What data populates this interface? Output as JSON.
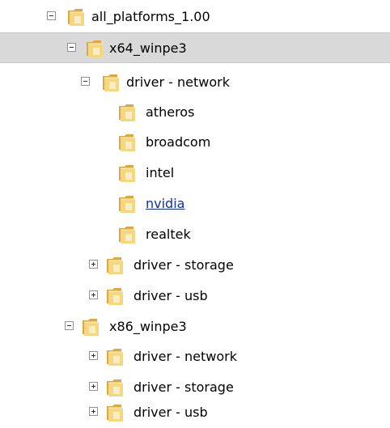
{
  "tree": {
    "items": [
      {
        "label": "all_platforms_1.00",
        "expander": "minus",
        "selected": false,
        "link": false
      },
      {
        "label": "x64_winpe3",
        "expander": "minus",
        "selected": true,
        "link": false
      },
      {
        "label": "driver - network",
        "expander": "minus",
        "selected": false,
        "link": false
      },
      {
        "label": "atheros",
        "expander": "none",
        "selected": false,
        "link": false
      },
      {
        "label": "broadcom",
        "expander": "none",
        "selected": false,
        "link": false
      },
      {
        "label": "intel",
        "expander": "none",
        "selected": false,
        "link": false
      },
      {
        "label": "nvidia",
        "expander": "none",
        "selected": false,
        "link": true
      },
      {
        "label": "realtek",
        "expander": "none",
        "selected": false,
        "link": false
      },
      {
        "label": "driver - storage",
        "expander": "plus",
        "selected": false,
        "link": false
      },
      {
        "label": "driver - usb",
        "expander": "plus",
        "selected": false,
        "link": false
      },
      {
        "label": "x86_winpe3",
        "expander": "minus",
        "selected": false,
        "link": false
      },
      {
        "label": "driver - network",
        "expander": "plus",
        "selected": false,
        "link": false
      },
      {
        "label": "driver - storage",
        "expander": "plus",
        "selected": false,
        "link": false
      },
      {
        "label": "driver - usb",
        "expander": "plus",
        "selected": false,
        "link": false
      }
    ]
  },
  "colors": {
    "selection_background": "#d9d9d9",
    "link_text": "#0d2fb8",
    "folder_body": "#f4d77e",
    "folder_tab": "#d8a948"
  }
}
